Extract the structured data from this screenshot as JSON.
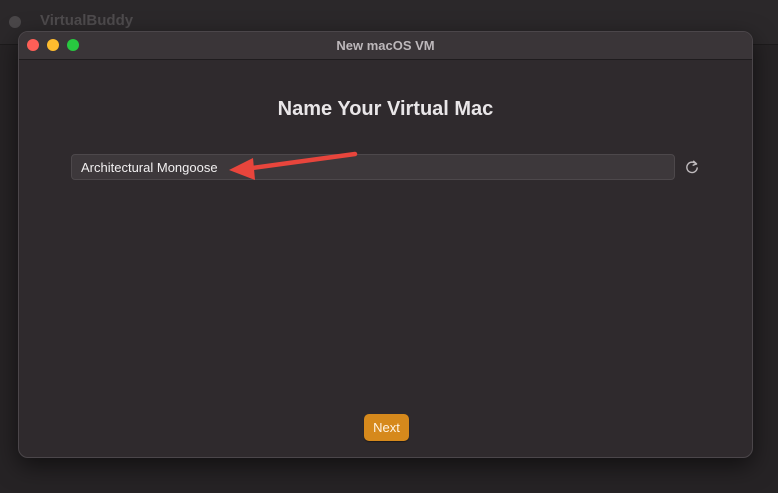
{
  "background_app": {
    "title": "VirtualBuddy"
  },
  "window": {
    "title": "New macOS VM",
    "traffic_lights": [
      "close",
      "minimize",
      "zoom"
    ]
  },
  "main": {
    "heading": "Name Your Virtual Mac",
    "name_field": {
      "value": "Architectural Mongoose"
    },
    "refresh_icon": "refresh-icon",
    "next_label": "Next"
  },
  "annotation": {
    "arrow_color": "#e8453c"
  },
  "colors": {
    "accent": "#d6891c",
    "close": "#fe5f57",
    "minimize": "#febc2e",
    "zoom": "#28c840"
  }
}
